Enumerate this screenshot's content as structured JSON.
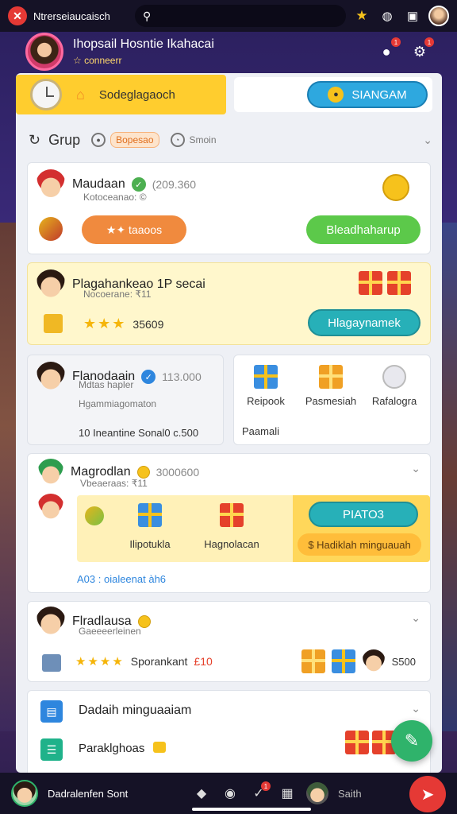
{
  "topbar": {
    "app_name": "Ntrerseiaucaisch"
  },
  "header": {
    "title": "Ihopsail Hosntie Ikahacai",
    "subtitle": "☆ conneerr"
  },
  "tabs": {
    "active_label": "Sodeglagaoch",
    "signup_label": "SIANGAM"
  },
  "filters": {
    "group_label": "Grup",
    "chip1": "Bopesao",
    "chip2": "Smoin"
  },
  "card1": {
    "name": "Maudaan",
    "number": "(209.360",
    "subtitle": "Kotoceanao: ©",
    "orange_btn": "★✦ taaoos",
    "green_btn": "Bleadhaharup"
  },
  "card2": {
    "name": "Plagahankeao 1P secai",
    "subtitle": "Nocoerane: ₹11",
    "score": "35609",
    "teal_btn": "Hlagaynamek"
  },
  "card3": {
    "name": "Flanodaain",
    "number": "113.000",
    "subtitle": "Mdtas hapler",
    "line2": "Hgammiagomaton",
    "line3": "10 Ineantine Sonal0 c.500",
    "icons": [
      "Reipook",
      "Pasmesiah",
      "Rafalogra"
    ],
    "footer": "Paamali"
  },
  "card4": {
    "name": "Magrodlan",
    "number": "3000600",
    "subtitle": "Vbeaeraas: ₹11",
    "gift1_label": "Ilipotukla",
    "gift2_label": "Hagnolacan",
    "teal_pill": "PIATO3",
    "orange_pill": "$ Hadiklah minguauah",
    "footer": "A03 : oialeenat àh6"
  },
  "card5": {
    "name": "Flradlausa",
    "subtitle": "Gaeeeerleinen",
    "rating_text": "Sporankant",
    "rating_num": "£10",
    "right_num": "S500"
  },
  "card6": {
    "title": "Dadaih minguaaiam",
    "item": "Paraklghoas"
  },
  "bottombar": {
    "me_name": "Dadralenfen Sont",
    "right_text": "Saith"
  },
  "colors": {
    "accent_yellow": "#ffcd2e",
    "signup_blue": "#2ea8df",
    "green": "#5cc94a",
    "orange": "#f08a3e",
    "teal": "#27b0b8",
    "red": "#e53935"
  }
}
